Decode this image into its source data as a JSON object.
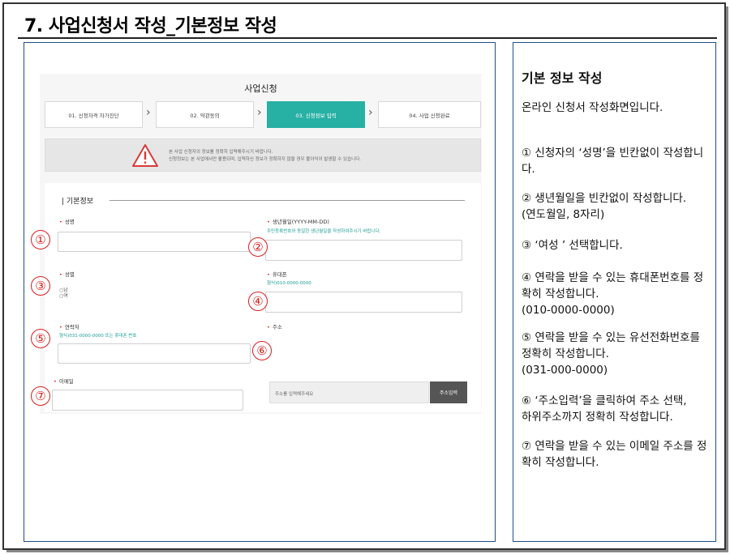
{
  "page": {
    "title": "7. 사업신청서 작성_기본정보 작성"
  },
  "form": {
    "heading": "사업신청",
    "steps": [
      {
        "label": "01. 신청자격 자가진단",
        "active": false
      },
      {
        "label": "02. 약관동의",
        "active": false
      },
      {
        "label": "03. 신청정보 입력",
        "active": true
      },
      {
        "label": "04. 사업 신청완료",
        "active": false
      }
    ],
    "notice": {
      "line1": "본 사업 신청자의 정보를 정확히 입력해주시기 바랍니다.",
      "line2": "신청정보는 본 사업에서만 활용되며, 입력하신 정보가 정확하지 않을 경우 불이익이 발생할 수 있습니다."
    },
    "section_title": "| 기본정보",
    "fields": {
      "name": {
        "label": "성명"
      },
      "birth": {
        "label": "생년월일(YYYY-MM-DD)",
        "hint": "주민등록번호와 동일한 생년월일을 작성하여주시기 바랍니다."
      },
      "gender": {
        "label": "성별",
        "options": [
          "남",
          "여"
        ]
      },
      "mobile": {
        "label": "휴대폰",
        "hint": "형식)010-0000-0000"
      },
      "phone": {
        "label": "연락처",
        "hint": "형식)031-0000-0000 또는 휴대폰 번호"
      },
      "address": {
        "label": "주소",
        "placeholder": "주소를 입력해주세요",
        "button": "주소입력"
      },
      "email": {
        "label": "이메일"
      }
    },
    "required_mark": "•"
  },
  "markers": [
    "①",
    "②",
    "③",
    "④",
    "⑤",
    "⑥",
    "⑦"
  ],
  "explain": {
    "title": "기본 정보 작성",
    "intro": "온라인 신청서 작성화면입니다.",
    "items": [
      "① 신청자의 ‘성명’을 빈칸없이 작성합니다.",
      "② 생년월일을 빈칸없이 작성합니다.\n  (연도월일, 8자리)",
      "③ ‘여성 ’ 선택합니다.",
      "④ 연락을 받을 수 있는 휴대폰번호를 정확히 작성합니다.\n(010-0000-0000)",
      "⑤ 연락을 받을 수 있는 유선전화번호를 정확히 작성합니다.\n(031-000-0000)",
      "⑥ ‘주소입력’을 클릭하여 주소 선택,\n  하위주소까지 정확히 작성합니다.",
      "⑦ 연락을 받을 수 있는 이메일 주소를 정확히 작성합니다."
    ]
  },
  "colors": {
    "accent": "#27b0a4",
    "marker": "#d61e1e",
    "panel_border": "#1f4e8a",
    "required": "#ee2233"
  }
}
